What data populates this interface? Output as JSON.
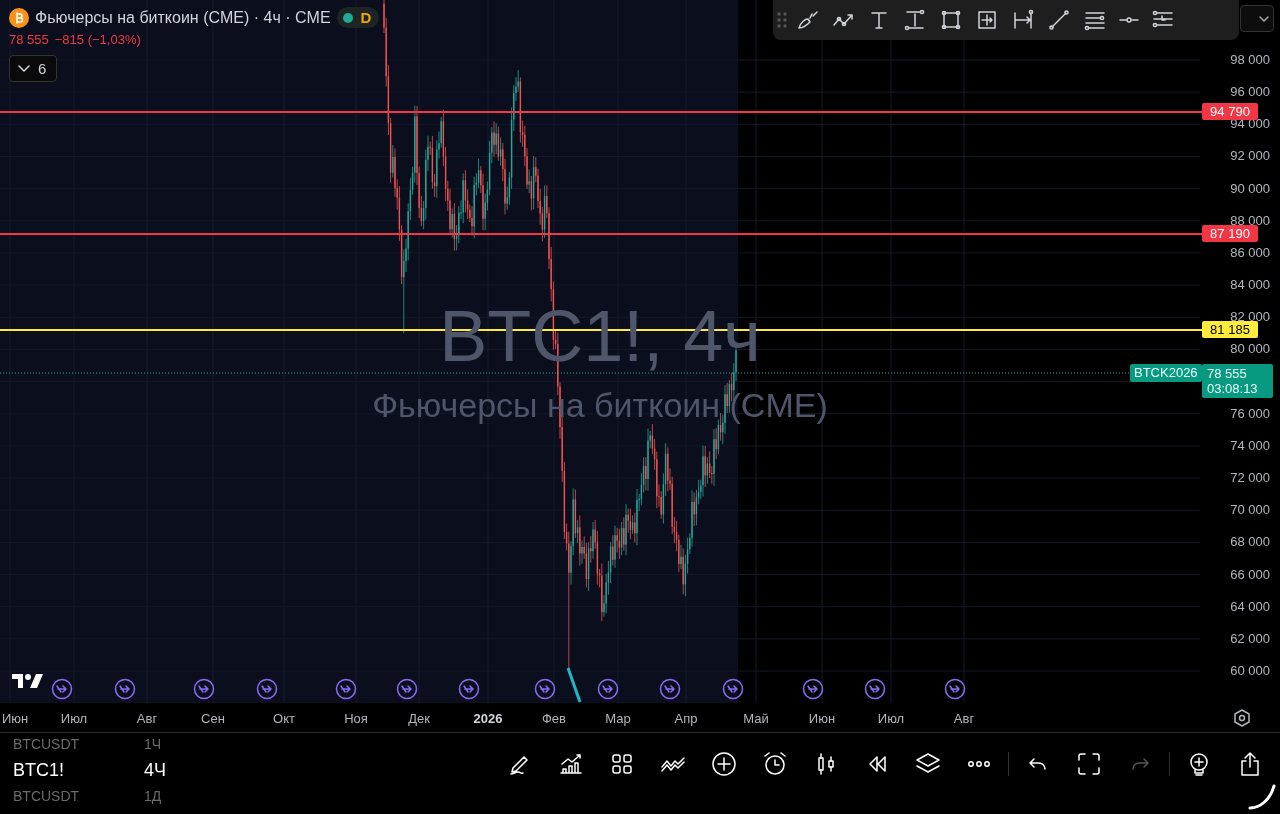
{
  "header": {
    "title": "Фьючерсы на биткоин (CME) · 4ч · CME",
    "badge": "D",
    "last_price": "78 555",
    "change": "−815 (−1,03%)",
    "collapse_count": "6"
  },
  "watermark": {
    "ticker": "BTC1!, 4ч",
    "name": "Фьючерсы на биткоин (CME)"
  },
  "price_scale": {
    "ticks": [
      "98 000",
      "96 000",
      "94 000",
      "92 000",
      "90 000",
      "88 000",
      "86 000",
      "84 000",
      "82 000",
      "80 000",
      "76 000",
      "74 000",
      "72 000",
      "70 000",
      "68 000",
      "66 000",
      "64 000",
      "62 000",
      "60 000"
    ]
  },
  "levels": [
    {
      "label": "94 790",
      "color": "#f23645"
    },
    {
      "label": "87 190",
      "color": "#f23645"
    },
    {
      "label": "81 185",
      "color": "#ffeb3b"
    }
  ],
  "price_label": {
    "symbol": "BTCK2026",
    "price": "78 555",
    "countdown": "03:08:13"
  },
  "time_axis": {
    "labels": [
      {
        "text": "Июн",
        "bold": false
      },
      {
        "text": "Июл",
        "bold": false
      },
      {
        "text": "Авг",
        "bold": false
      },
      {
        "text": "Сен",
        "bold": false
      },
      {
        "text": "Окт",
        "bold": false
      },
      {
        "text": "Ноя",
        "bold": false
      },
      {
        "text": "Дек",
        "bold": false
      },
      {
        "text": "2026",
        "bold": true
      },
      {
        "text": "Фев",
        "bold": false
      },
      {
        "text": "Мар",
        "bold": false
      },
      {
        "text": "Апр",
        "bold": false
      },
      {
        "text": "Май",
        "bold": false
      },
      {
        "text": "Июн",
        "bold": false
      },
      {
        "text": "Июл",
        "bold": false
      },
      {
        "text": "Авг",
        "bold": false
      }
    ]
  },
  "symbol_wheel": [
    {
      "symbol": "BTCUSDT",
      "interval": "1Ч",
      "selected": false
    },
    {
      "symbol": "BTC1!",
      "interval": "4Ч",
      "selected": true
    },
    {
      "symbol": "BTCUSDT",
      "interval": "1Д",
      "selected": false
    }
  ],
  "history": {
    "undo_disabled": false,
    "redo_disabled": true
  }
}
